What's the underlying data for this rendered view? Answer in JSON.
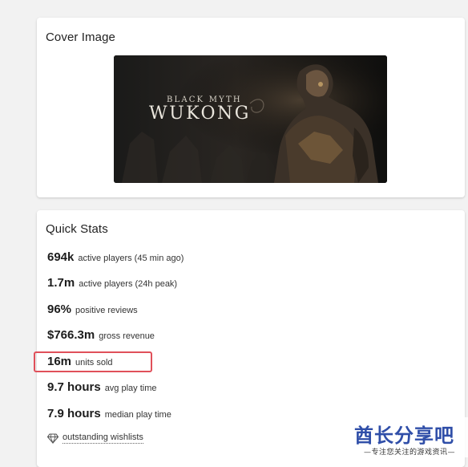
{
  "cover_card": {
    "title": "Cover Image",
    "game_logo_top": "BLACK MYTH",
    "game_logo_main": "WUKONG"
  },
  "stats_card": {
    "title": "Quick Stats",
    "stats": [
      {
        "value": "694k",
        "label": "active players (45 min ago)"
      },
      {
        "value": "1.7m",
        "label": "active players (24h peak)"
      },
      {
        "value": "96%",
        "label": "positive reviews"
      },
      {
        "value": "$766.3m",
        "label": "gross revenue"
      },
      {
        "value": "16m",
        "label": "units sold"
      },
      {
        "value": "9.7 hours",
        "label": "avg play time"
      },
      {
        "value": "7.9 hours",
        "label": "median play time"
      }
    ],
    "wishlist_link": "outstanding wishlists",
    "highlight_color": "#e0505a"
  },
  "watermark": {
    "main": "酋长分享吧",
    "sub": "—专注您关注的游戏资讯—"
  }
}
